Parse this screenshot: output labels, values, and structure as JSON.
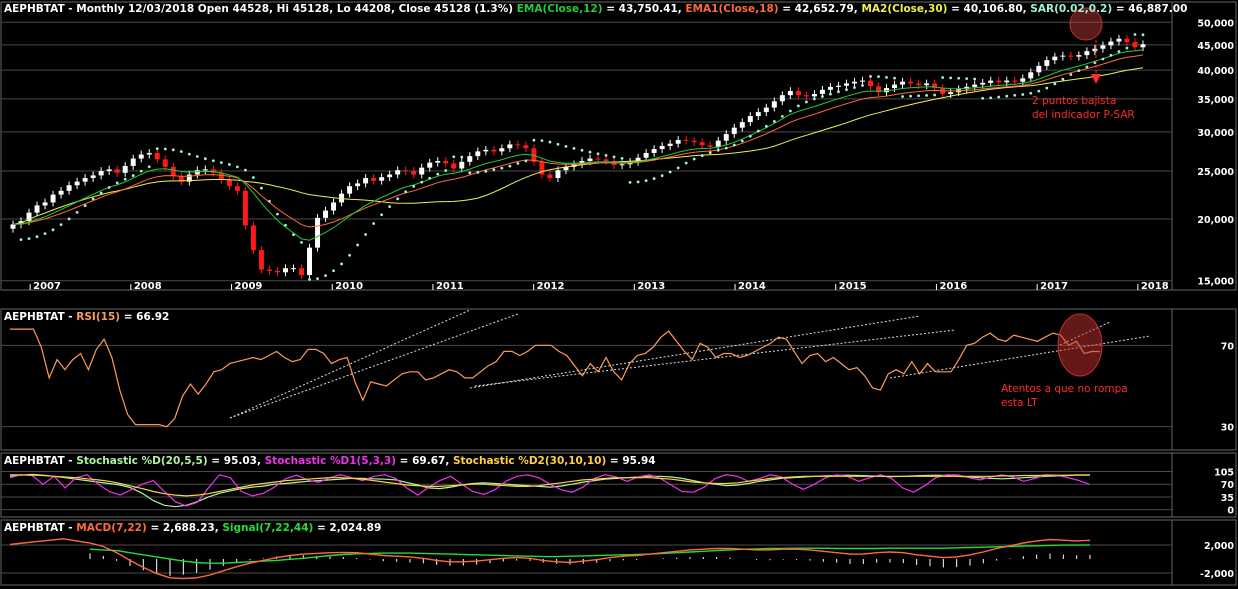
{
  "colors": {
    "bg": "#000000",
    "up": "#ffffff",
    "down": "#ff1a1a",
    "ema": "#22cc33",
    "ema1": "#ff6a3a",
    "ma2": "#f0f050",
    "sar": "#9ef3d8",
    "rsi": "#ff9a55",
    "stoch_d": "#b0f3a0",
    "stoch_d1": "#ee33ee",
    "stoch_d2": "#ffd040",
    "macd": "#ff6a3a",
    "signal": "#22dd33",
    "hist": "#ffffff",
    "annot": "#ff2a2a",
    "grid": "#4a4a4a"
  },
  "headers": {
    "price": {
      "prefix": "AEPHBTAT - Monthly 12/03/2018 Open 44528, Hi 45128, Lo 44208, Close 45128 (1.3%) ",
      "ema_label": "EMA(Close,12)",
      "ema_val": " = 43,750.41, ",
      "ema1_label": "EMA1(Close,18)",
      "ema1_val": " = 42,652.79, ",
      "ma2_label": "MA2(Close,30)",
      "ma2_val": " = 40,106.80, ",
      "sar_label": "SAR(0.02,0.2)",
      "sar_val": " = 46,887.00"
    },
    "rsi": {
      "prefix": "AEPHBTAT - ",
      "label": "RSI(15)",
      "val": " = 66.92"
    },
    "stoch": {
      "prefix": "AEPHBTAT - ",
      "d_label": "Stochastic %D(20,5,5)",
      "d_val": " = 95.03, ",
      "d1_label": "Stochastic %D1(5,3,3)",
      "d1_val": " = 69.67, ",
      "d2_label": "Stochastic %D2(30,10,10)",
      "d2_val": " = 95.94"
    },
    "macd": {
      "prefix": "AEPHBTAT - ",
      "macd_label": "MACD(7,22)",
      "macd_val": " = 2,688.23, ",
      "signal_label": "Signal(7,22,44)",
      "signal_val": " = 2,024.89"
    }
  },
  "annotations": {
    "sar": "2 puntos bajista\ndel indicador P-SAR",
    "rsi": "Atentos a que no rompa\nesta LT"
  },
  "chart_data": [
    {
      "type": "candlestick",
      "title": "AEPHBTAT - Monthly",
      "scale": "log",
      "ylim": [
        14500,
        51000
      ],
      "yticks": [
        15000,
        20000,
        25000,
        30000,
        35000,
        40000,
        45000,
        50000
      ],
      "ytick_labels": [
        "15,000",
        "20,000",
        "25,000",
        "30,000",
        "35,000",
        "40,000",
        "45,000",
        "50,000"
      ],
      "xticks": [
        "2007",
        "2008",
        "2009",
        "2010",
        "2011",
        "2012",
        "2013",
        "2014",
        "2015",
        "2016",
        "2017",
        "2018"
      ],
      "xtick_dates": [
        2007,
        2008,
        2009,
        2010,
        2011,
        2012,
        2013,
        2014,
        2015,
        2016,
        2017,
        2018
      ],
      "x_start": 2006.8,
      "x_end": 2018.22,
      "close": [
        19500,
        19800,
        20600,
        21300,
        21600,
        22400,
        22800,
        23400,
        23800,
        24200,
        24500,
        25000,
        25200,
        24800,
        25600,
        26500,
        27000,
        27200,
        26400,
        25500,
        24400,
        23800,
        24600,
        25100,
        25200,
        24800,
        24000,
        23300,
        22800,
        19400,
        17300,
        15800,
        15700,
        15600,
        15900,
        15900,
        15400,
        17500,
        20100,
        20800,
        21600,
        22500,
        23300,
        23600,
        24200,
        23900,
        24300,
        24600,
        25100,
        25000,
        24600,
        25400,
        26000,
        26200,
        25900,
        25300,
        26100,
        26800,
        27400,
        27600,
        27400,
        27800,
        28300,
        28200,
        27800,
        26100,
        24600,
        24200,
        25100,
        25500,
        25800,
        26200,
        26500,
        26400,
        26200,
        25700,
        25800,
        26100,
        26600,
        27200,
        27700,
        28100,
        28400,
        28900,
        28800,
        28600,
        28200,
        28000,
        28800,
        29700,
        30600,
        31400,
        32300,
        32900,
        33600,
        34600,
        35600,
        36300,
        35600,
        35400,
        35800,
        36500,
        37000,
        37200,
        37600,
        37900,
        38100,
        37100,
        36100,
        36800,
        37400,
        37900,
        37600,
        37300,
        37600,
        36800,
        35800,
        36100,
        36600,
        37000,
        37400,
        37700,
        38100,
        37800,
        38100,
        37900,
        38500,
        39600,
        40800,
        41900,
        42600,
        42800,
        42600,
        42900,
        43700,
        44200,
        44900,
        45700,
        46300,
        45600,
        44500,
        45128
      ],
      "sar_points": "dotted, below price in uptrends and above price in downtrends"
    },
    {
      "type": "line",
      "name": "RSI(15)",
      "ylim": [
        20,
        80
      ],
      "yticks": [
        30,
        70
      ],
      "ytick_labels": [
        "30",
        "70"
      ],
      "values": [
        78,
        78,
        78,
        78,
        69,
        54,
        63,
        58,
        63,
        66,
        58,
        68,
        73,
        64,
        48,
        36,
        31,
        31,
        31,
        31,
        30,
        34,
        45,
        51,
        46,
        51,
        57,
        58,
        61,
        62,
        63,
        64,
        63,
        65,
        67,
        64,
        62,
        63,
        68,
        68,
        66,
        61,
        63,
        64,
        52,
        43,
        52,
        51,
        50,
        53,
        56,
        57,
        57,
        53,
        54,
        56,
        58,
        57,
        54,
        54,
        57,
        60,
        62,
        67,
        67,
        65,
        67,
        70,
        70,
        70,
        67,
        65,
        60,
        55,
        61,
        57,
        64,
        57,
        53,
        61,
        65,
        66,
        69,
        74,
        77,
        72,
        67,
        63,
        71,
        69,
        64,
        66,
        66,
        64,
        65,
        67,
        69,
        71,
        74,
        73,
        67,
        61,
        65,
        66,
        62,
        64,
        61,
        58,
        59,
        55,
        49,
        48,
        56,
        58,
        56,
        62,
        56,
        61,
        57,
        57,
        57,
        63,
        70,
        71,
        74,
        76,
        73,
        72,
        75,
        74,
        73,
        72,
        74,
        76,
        75,
        70,
        72,
        66,
        67,
        66.92
      ]
    },
    {
      "type": "line",
      "name": "Stochastic",
      "ylim": [
        -12,
        112
      ],
      "yticks": [
        105,
        70,
        35,
        0
      ],
      "ytick_labels": [
        "105",
        "70",
        "35",
        "0"
      ],
      "series": [
        {
          "name": "Stochastic %D(20,5,5)",
          "values": [
            92,
            95,
            97,
            95,
            92,
            88,
            84,
            80,
            76,
            72,
            68,
            60,
            45,
            25,
            12,
            8,
            12,
            22,
            35,
            45,
            52,
            58,
            62,
            65,
            70,
            72,
            75,
            78,
            80,
            82,
            84,
            86,
            86,
            85,
            84,
            82,
            75,
            68,
            60,
            58,
            62,
            68,
            72,
            74,
            72,
            70,
            68,
            66,
            64,
            62,
            65,
            70,
            76,
            80,
            84,
            86,
            88,
            90,
            92,
            92,
            90,
            86,
            80,
            74,
            70,
            66,
            68,
            72,
            78,
            82,
            86,
            88,
            90,
            92,
            93,
            94,
            95,
            94,
            93,
            92,
            91,
            92,
            93,
            94,
            95,
            94,
            92,
            90,
            88,
            86,
            85,
            86,
            88,
            90,
            92,
            93,
            94,
            95,
            95.03
          ]
        },
        {
          "name": "Stochastic %D1(5,3,3)",
          "values": [
            88,
            96,
            94,
            70,
            92,
            60,
            88,
            96,
            70,
            50,
            40,
            55,
            70,
            80,
            50,
            22,
            10,
            20,
            60,
            96,
            88,
            50,
            38,
            45,
            62,
            85,
            95,
            82,
            75,
            88,
            96,
            88,
            80,
            92,
            96,
            86,
            60,
            40,
            62,
            80,
            92,
            70,
            50,
            42,
            55,
            78,
            92,
            96,
            88,
            70,
            55,
            48,
            62,
            86,
            96,
            90,
            78,
            90,
            96,
            86,
            68,
            50,
            48,
            62,
            86,
            96,
            92,
            78,
            86,
            96,
            90,
            70,
            56,
            70,
            88,
            96,
            92,
            78,
            88,
            96,
            86,
            60,
            48,
            66,
            88,
            96,
            96,
            88,
            82,
            90,
            96,
            90,
            78,
            86,
            96,
            94,
            88,
            80,
            69.67
          ]
        },
        {
          "name": "Stochastic %D2(30,10,10)",
          "values": [
            96,
            96,
            95,
            94,
            92,
            90,
            88,
            85,
            82,
            78,
            72,
            65,
            58,
            50,
            44,
            40,
            38,
            40,
            44,
            50,
            56,
            62,
            68,
            72,
            76,
            80,
            82,
            84,
            86,
            88,
            88,
            86,
            84,
            80,
            76,
            72,
            68,
            66,
            64,
            64,
            66,
            68,
            70,
            70,
            68,
            66,
            64,
            64,
            66,
            70,
            74,
            78,
            82,
            84,
            86,
            88,
            88,
            88,
            88,
            86,
            84,
            80,
            76,
            74,
            72,
            72,
            74,
            78,
            82,
            86,
            88,
            90,
            92,
            92,
            92,
            92,
            92,
            92,
            92,
            92,
            92,
            92,
            92,
            92,
            92,
            92,
            92,
            92,
            92,
            92,
            93,
            93,
            94,
            94,
            95,
            95,
            95,
            96,
            95.94
          ]
        }
      ]
    },
    {
      "type": "line",
      "name": "MACD",
      "ylim": [
        -3300,
        3300
      ],
      "yticks": [
        2000,
        -2000
      ],
      "ytick_labels": [
        "2,000",
        "-2,000"
      ],
      "series": [
        {
          "name": "MACD(7,22)",
          "values": [
            2100,
            2300,
            2500,
            2700,
            2900,
            2600,
            2300,
            1800,
            900,
            -200,
            -1200,
            -2100,
            -2700,
            -2800,
            -2700,
            -2300,
            -1700,
            -1100,
            -600,
            -200,
            200,
            500,
            700,
            800,
            900,
            950,
            900,
            700,
            500,
            400,
            300,
            100,
            -200,
            -400,
            -400,
            -300,
            -100,
            100,
            200,
            100,
            -200,
            -400,
            -500,
            -300,
            -100,
            200,
            400,
            500,
            700,
            900,
            1100,
            1300,
            1400,
            1500,
            1500,
            1400,
            1300,
            1300,
            1400,
            1400,
            1300,
            1100,
            900,
            700,
            700,
            900,
            1000,
            900,
            600,
            400,
            200,
            300,
            600,
            1000,
            1500,
            1900,
            2300,
            2600,
            2800,
            2700,
            2600,
            2688.23
          ]
        },
        {
          "name": "Signal(7,22,44)",
          "values": [
            null,
            null,
            null,
            null,
            null,
            null,
            1400,
            1300,
            1200,
            900,
            600,
            300,
            0,
            -300,
            -500,
            -600,
            -600,
            -500,
            -400,
            -300,
            -200,
            -50,
            100,
            300,
            500,
            650,
            750,
            800,
            850,
            850,
            850,
            800,
            750,
            700,
            650,
            600,
            550,
            500,
            450,
            400,
            350,
            350,
            400,
            450,
            500,
            550,
            600,
            650,
            700,
            800,
            900,
            1000,
            1100,
            1200,
            1300,
            1400,
            1450,
            1500,
            1500,
            1550,
            1550,
            1550,
            1500,
            1500,
            1500,
            1500,
            1550,
            1550,
            1550,
            1550,
            1550,
            1600,
            1650,
            1700,
            1750,
            1800,
            1850,
            1900,
            1950,
            2000,
            2000,
            2024.89
          ]
        }
      ]
    }
  ]
}
